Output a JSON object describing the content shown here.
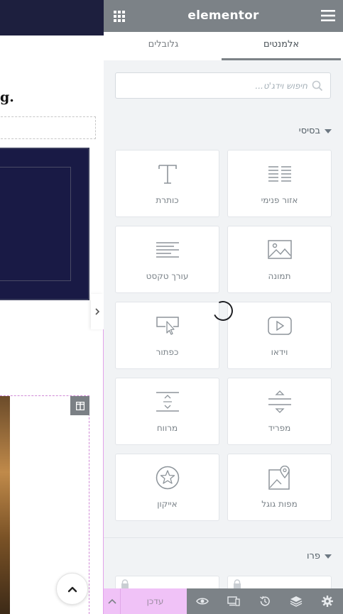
{
  "canvas": {
    "heading_fragment": "g."
  },
  "panel": {
    "logo": "elementor",
    "tabs": [
      {
        "label": "אלמנטים",
        "active": true
      },
      {
        "label": "גלובלים",
        "active": false
      }
    ],
    "search": {
      "placeholder": "חיפוש וידג'ט..."
    },
    "categories": {
      "basic": {
        "title": "בסיסי",
        "elements": [
          {
            "label": "אזור פנימי",
            "icon": "inner-section-icon"
          },
          {
            "label": "כותרת",
            "icon": "heading-icon"
          },
          {
            "label": "תמונה",
            "icon": "image-icon"
          },
          {
            "label": "עורך טקסט",
            "icon": "text-editor-icon"
          },
          {
            "label": "וידאו",
            "icon": "video-icon"
          },
          {
            "label": "כפתור",
            "icon": "button-icon"
          },
          {
            "label": "מפריד",
            "icon": "divider-icon"
          },
          {
            "label": "מרווח",
            "icon": "spacer-icon"
          },
          {
            "label": "מפות גוגל",
            "icon": "google-maps-icon"
          },
          {
            "label": "אייקון",
            "icon": "star-icon"
          }
        ]
      },
      "pro": {
        "title": "פרו"
      }
    },
    "footer": {
      "update_label": "עדכן"
    },
    "colors": {
      "header": "#7c8287",
      "update": "#f0c2f7",
      "canvas_navy": "#191a45"
    }
  }
}
